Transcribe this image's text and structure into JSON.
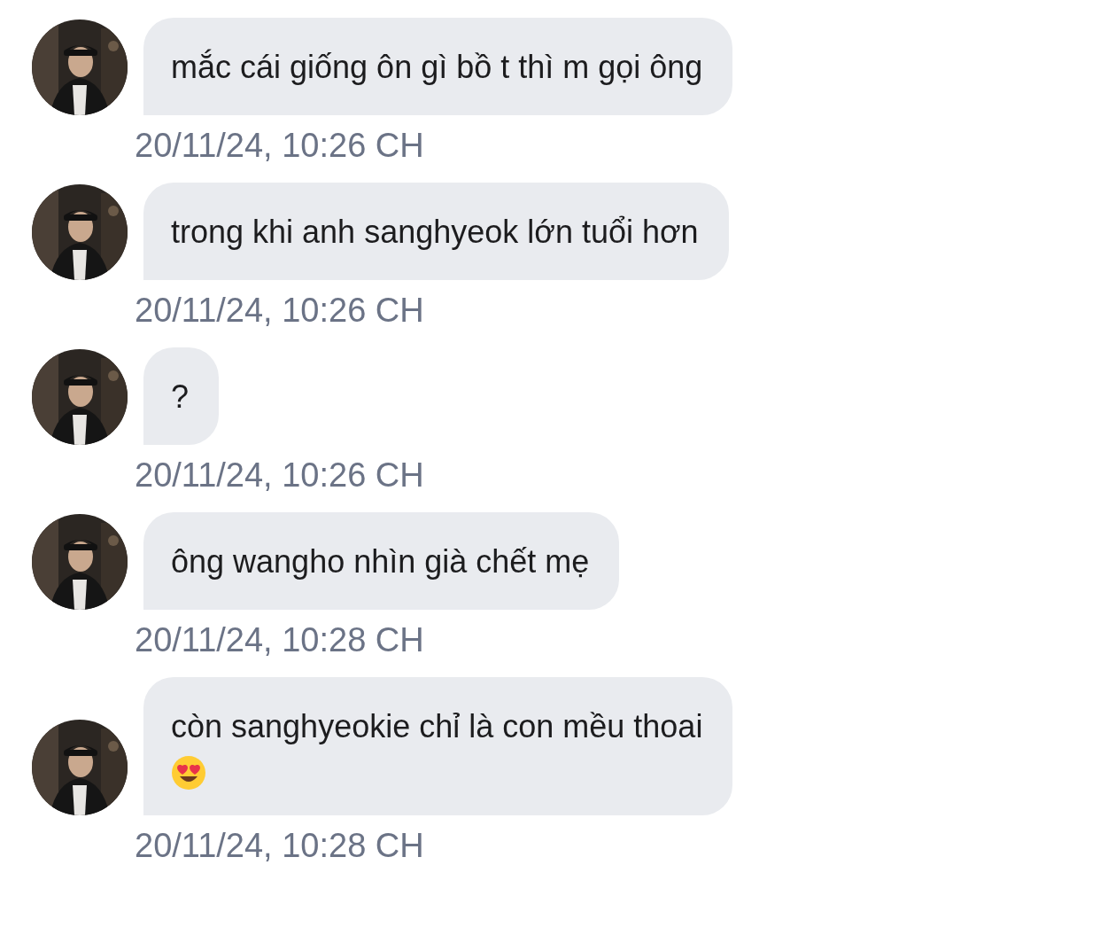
{
  "messages": [
    {
      "text": "mắc cái giống ôn gì bồ t thì m gọi ông",
      "emoji": false,
      "time": "20/11/24, 10:26 CH"
    },
    {
      "text": "trong khi anh sanghyeok lớn tuổi hơn",
      "emoji": false,
      "time": "20/11/24, 10:26 CH"
    },
    {
      "text": "?",
      "emoji": false,
      "time": "20/11/24, 10:26 CH"
    },
    {
      "text": "ông wangho nhìn già chết mẹ",
      "emoji": false,
      "time": "20/11/24, 10:28 CH"
    },
    {
      "text": "còn sanghyeokie chỉ là con mều thoai",
      "emoji": true,
      "time": "20/11/24, 10:28 CH"
    }
  ]
}
